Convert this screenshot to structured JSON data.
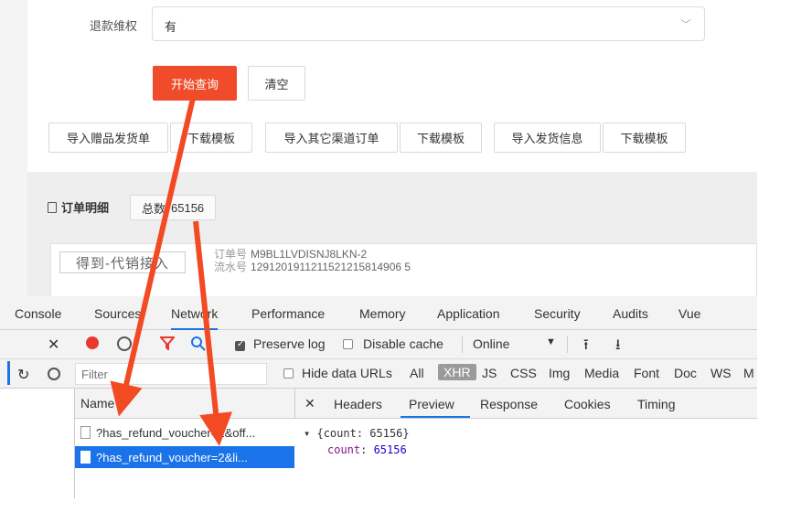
{
  "form": {
    "refund_label": "退款维权",
    "refund_value": "有",
    "search_button": "开始查询",
    "clear_button": "清空"
  },
  "import_buttons": [
    {
      "label": "导入赠品发货单"
    },
    {
      "label": "下载模板"
    },
    {
      "label": "导入其它渠道订单"
    },
    {
      "label": "下载模板"
    },
    {
      "label": "导入发货信息"
    },
    {
      "label": "下载模板"
    }
  ],
  "order_detail": {
    "title": "订单明细",
    "total_label": "总数",
    "total_value": "65156",
    "shop_name": "得到-代销接入",
    "order_no_label": "订单号",
    "order_no": "M9BL1LVDISNJ8LKN-2",
    "serial_no_label": "流水号",
    "serial_no": "1291201911211521215814906 5"
  },
  "devtools": {
    "tabs": [
      "Console",
      "Sources",
      "Network",
      "Performance",
      "Memory",
      "Application",
      "Security",
      "Audits",
      "Vue"
    ],
    "active_tab": "Network",
    "toolbar": {
      "preserve_log": "Preserve log",
      "disable_cache": "Disable cache",
      "throttle": "Online"
    },
    "filter": {
      "placeholder": "Filter",
      "hide_data_urls": "Hide data URLs",
      "types": [
        "All",
        "XHR",
        "JS",
        "CSS",
        "Img",
        "Media",
        "Font",
        "Doc",
        "WS",
        "M"
      ]
    },
    "name_header": "Name",
    "requests": [
      {
        "name": "?has_refund_voucher=2&off..."
      },
      {
        "name": "?has_refund_voucher=2&li..."
      }
    ],
    "detail_tabs": [
      "Headers",
      "Preview",
      "Response",
      "Cookies",
      "Timing"
    ],
    "active_detail_tab": "Preview",
    "preview": {
      "summary": "{count: 65156}",
      "key": "count",
      "value": "65156"
    }
  },
  "colors": {
    "primary": "#f04b2a",
    "devtools_blue": "#1a73e8",
    "record_red": "#e8392c",
    "annotation_arrow": "#f24a23"
  }
}
